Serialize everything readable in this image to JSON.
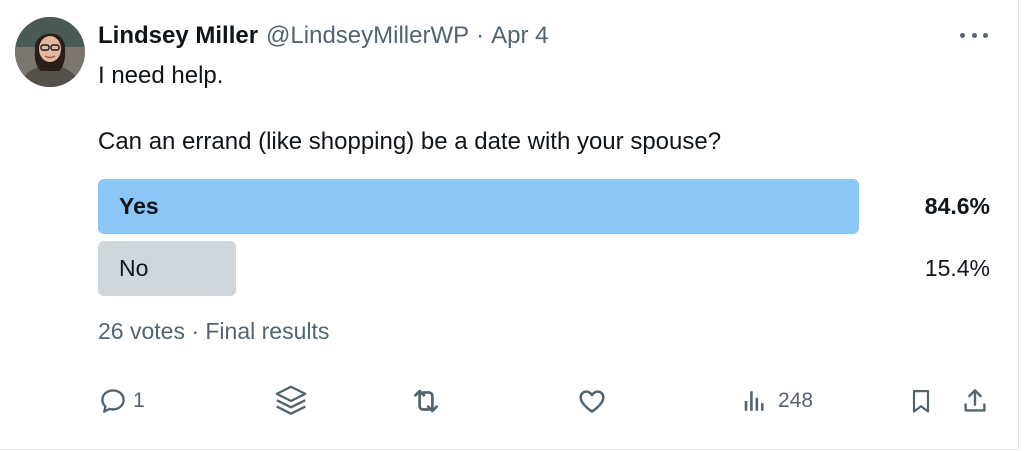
{
  "tweet": {
    "author_name": "Lindsey Miller",
    "handle": "@LindseyMillerWP",
    "separator": "·",
    "date": "Apr 4",
    "text_line_1": "I need help.",
    "text_line_2": "Can an errand (like shopping) be a date with your spouse?"
  },
  "poll": {
    "options": [
      {
        "label": "Yes",
        "percent": "84.6%",
        "fraction": 0.846,
        "color": "#8bc6f5",
        "leading": true
      },
      {
        "label": "No",
        "percent": "15.4%",
        "fraction": 0.154,
        "color": "#d0d7dc",
        "leading": false
      }
    ],
    "votes": "26 votes",
    "separator": "·",
    "status": "Final results",
    "results_text": "26 votes · Final results"
  },
  "actions": {
    "reply_count": "1",
    "views_count": "248",
    "icons": [
      "reply-icon",
      "stack-icon",
      "retweet-icon",
      "like-icon",
      "views-icon",
      "bookmark-icon",
      "share-icon"
    ]
  },
  "colors": {
    "text_primary": "#0f1419",
    "text_secondary": "#536471",
    "accent_bar": "#8bc6f5",
    "neutral_bar": "#d0d7dc"
  }
}
